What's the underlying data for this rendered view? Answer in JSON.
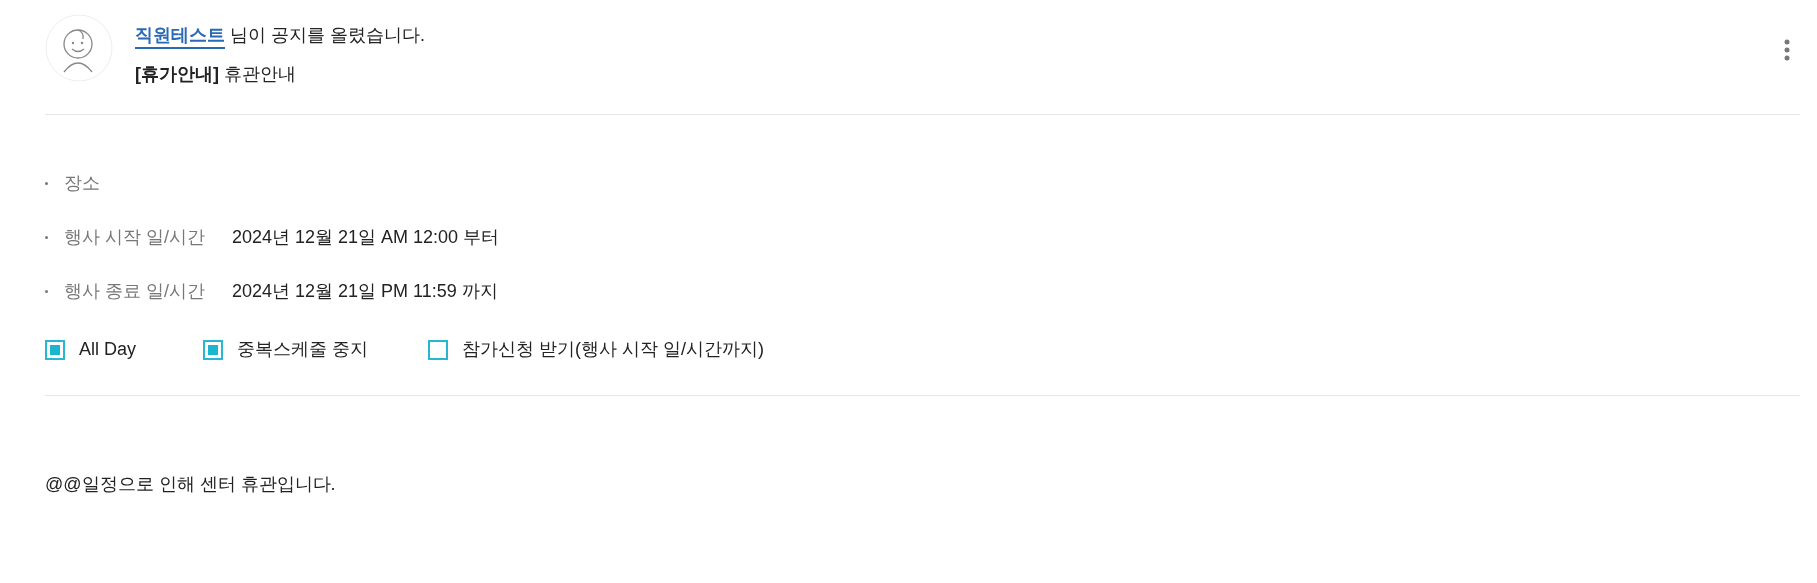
{
  "notice": {
    "author": "직원테스트",
    "action": "님이 공지를 올렸습니다.",
    "title": "**[휴가안내]** 휴관안내"
  },
  "details": [
    {
      "label": "장소"
    },
    {
      "label": "행사 시작 일/시간",
      "value": "2024년 12월 21일 AM 12:00 부터"
    },
    {
      "label": "행사 종료 일/시간",
      "value": "2024년 12월 21일 PM 11:59 까지"
    }
  ],
  "options": [
    {
      "label": "All Day",
      "checked": true
    },
    {
      "label": "중복스케줄 중지",
      "checked": true
    },
    {
      "label": "참가신청 받기(행사 시작 일/시간까지)",
      "checked": false
    }
  ],
  "body": "@@일정으로 인해 센터 휴관입니다."
}
